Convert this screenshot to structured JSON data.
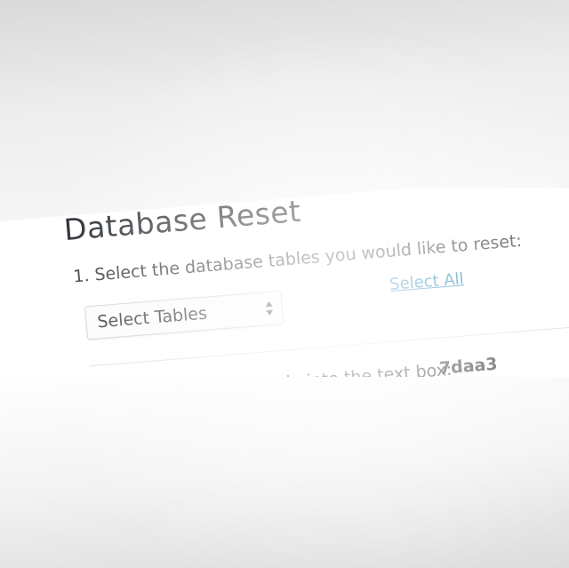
{
  "header": {
    "title": "Database Reset"
  },
  "steps": {
    "step1_text": "1. Select the database tables you would like to reset:",
    "select_label": "Select Tables",
    "select_all_label": "Select All",
    "step2_text": "2. Enter the security code into the text box:",
    "security_code": "7daa3"
  },
  "colors": {
    "link": "#0073aa",
    "text": "#333333",
    "title": "#23282d"
  },
  "icons": {
    "select_arrows": "up-down-caret-icon"
  }
}
